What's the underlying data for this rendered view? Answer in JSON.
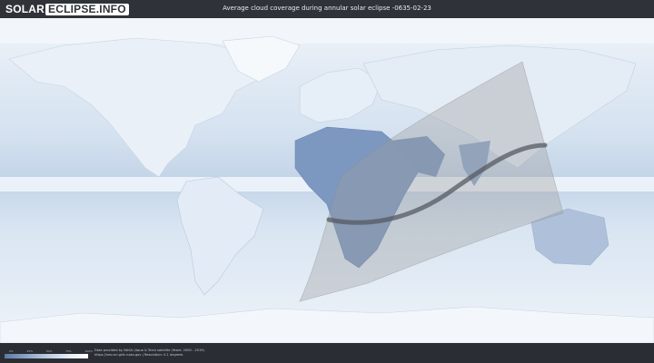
{
  "header": {
    "logo_solar": "SOLAR",
    "logo_eclipse": "ECLIPSE.INFO",
    "title": "Average cloud coverage during annular solar eclipse -0635-02-23"
  },
  "footer": {
    "scale_labels": [
      "0%",
      "25%",
      "50%",
      "75%",
      "100%"
    ],
    "credit_line1": "Data provided by NASA (Aqua & Terra satellite (Years: 2000 - 2019)",
    "credit_line2": "https://neo.sci.gsfc.nasa.gov | Resolution: 0.1 degrees"
  },
  "colors": {
    "map_base": "#e6eef7",
    "cloud_light": "#f7fafd",
    "clear_sky": "#6f8db8",
    "eclipse_zone": "#9a9a9a",
    "central_line": "#555a61"
  }
}
